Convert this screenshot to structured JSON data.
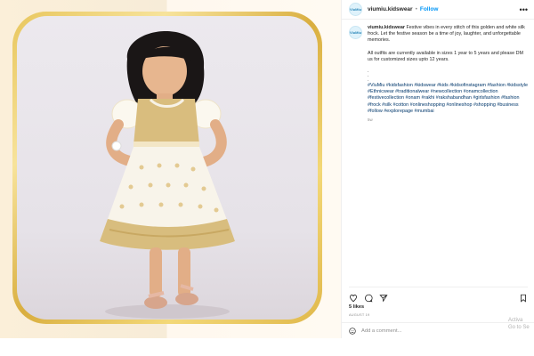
{
  "post": {
    "username": "viumiu.kidswear",
    "dot": "•",
    "follow_label": "Follow",
    "more_label": "•••",
    "avatar_label": "ViuMiu",
    "caption_username": "viumiu.kidswear",
    "caption_line1": "Festive vibes in every stitch of this golden and white silk frock. Let the festive season be a time of joy, laughter, and unforgettable memories.",
    "caption_line2": "All outfits are currently available in sizes 1 year to 5 years and please DM us for customized sizes upto 12 years.",
    "dots": ".\n.\n.",
    "hashtags": "#ViuMiu #kidsfashion #kidswear #kids #kidsofinstagram #fashion #kidsstyle #Ethnicwear #traditionalwear #newcollection #onamcollection #festivecollection #onam #rakhi #rakshabandhan #girlsfashion #fashion #frock #silk #cotton #onlineshopping #onlineshop #shopping #business #follow #explorepage #mumbai",
    "time_ago": "5w",
    "likes": "5 likes",
    "date": "AUGUST 19",
    "comment_placeholder": "Add a comment..."
  },
  "icons": {
    "like": "heart-icon",
    "comment": "comment-icon",
    "share": "share-icon",
    "save": "bookmark-icon",
    "emoji": "emoji-icon"
  },
  "colors": {
    "follow": "#0095f6",
    "hashtag": "#00376b",
    "frame_gold": "#e0b84b"
  },
  "watermark": {
    "line1": "Activa",
    "line2": "Go to Se"
  }
}
